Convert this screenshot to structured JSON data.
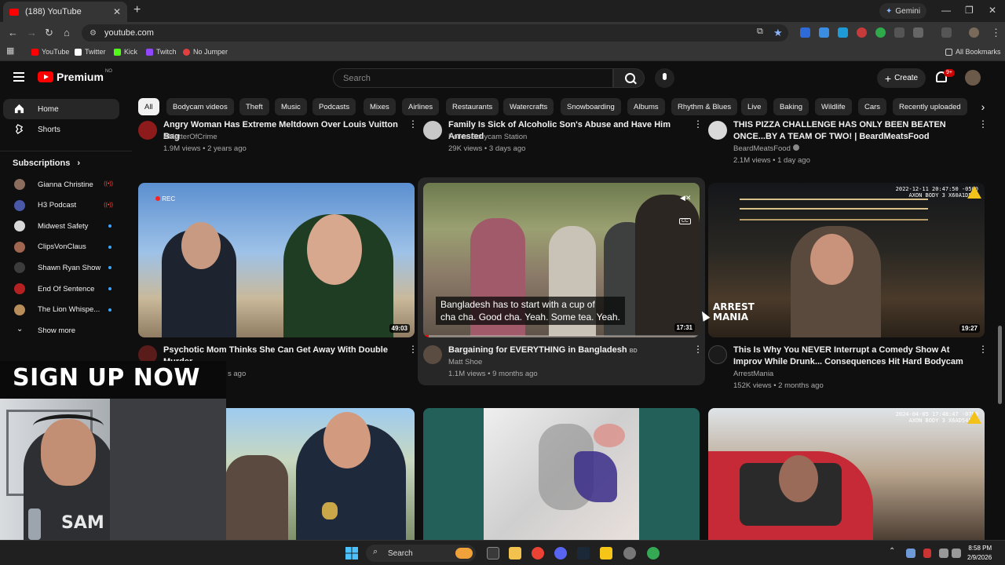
{
  "browser": {
    "tab_title": "(188) YouTube",
    "address": "youtube.com",
    "gemini_label": "Gemini",
    "bookmarks": [
      "YouTube",
      "Twitter",
      "Kick",
      "Twitch",
      "No Jumper"
    ],
    "all_bookmarks": "All Bookmarks"
  },
  "header": {
    "logo": "Premium",
    "logo_sup": "NO",
    "search_placeholder": "Search",
    "create_label": "Create",
    "notif_badge": "9+"
  },
  "sidebar": {
    "nav": [
      {
        "label": "Home",
        "icon": "home-icon"
      },
      {
        "label": "Shorts",
        "icon": "shorts-icon"
      }
    ],
    "subscriptions_title": "Subscriptions",
    "subscriptions": [
      {
        "label": "Gianna Christine",
        "status": "live",
        "color": "#8a6d5c"
      },
      {
        "label": "H3 Podcast",
        "status": "live",
        "color": "#4a58a8"
      },
      {
        "label": "Midwest Safety",
        "status": "dot",
        "color": "#d8d8d8"
      },
      {
        "label": "ClipsVonClaus",
        "status": "dot",
        "color": "#a0664f"
      },
      {
        "label": "Shawn Ryan Show",
        "status": "dot",
        "color": "#3c3c3c"
      },
      {
        "label": "End Of Sentence",
        "status": "dot",
        "color": "#b52020"
      },
      {
        "label": "The Lion Whispe...",
        "status": "dot",
        "color": "#b78d5a"
      }
    ],
    "show_more": "Show more"
  },
  "chips": [
    "All",
    "Bodycam videos",
    "Theft",
    "Music",
    "Podcasts",
    "Mixes",
    "Airlines",
    "Restaurants",
    "Watercrafts",
    "Snowboarding",
    "Albums",
    "Rhythm & Blues",
    "Live",
    "Baking",
    "Wildlife",
    "Cars",
    "Recently uploaded"
  ],
  "videos_top": [
    {
      "title": "Angry Woman  Has Extreme Meltdown Over Louis Vuitton Bag",
      "channel": "AMatterOfCrime",
      "meta": "1.9M views • 2 years ago"
    },
    {
      "title": "Family Is Sick of Alcoholic Son's Abuse and Have Him Arrested",
      "channel": "Police Bodycam Station",
      "meta": "29K views • 3 days ago"
    },
    {
      "title": "THIS PIZZA CHALLENGE HAS ONLY BEEN BEATEN ONCE...BY A TEAM OF TWO! | BeardMeatsFood",
      "channel": "BeardMeatsFood",
      "meta": "2.1M views • 1 day ago"
    }
  ],
  "videos_mid": [
    {
      "title": "Psychotic Mom Thinks She Can Get Away With Double Murder",
      "channel": "",
      "meta": "s ago",
      "duration": "49:03",
      "rec_label": "REC"
    },
    {
      "title": "Bargaining for EVERYTHING in Bangladesh",
      "title_flag": "BD",
      "channel": "Matt Shoe",
      "meta": "1.1M views • 9 months ago",
      "duration": "17:31",
      "caption_line1": "Bangladesh has to start with a cup of",
      "caption_line2": "cha cha. Good cha. Yeah. Some tea. Yeah.",
      "cc": "CC",
      "progress": 0.02
    },
    {
      "title": "This Is Why You NEVER Interrupt a Comedy Show At Improv While Drunk... Consequences Hit Hard Bodycam",
      "channel": "ArrestMania",
      "meta": "152K views • 2 months ago",
      "duration": "19:27",
      "stamp": "2022-12-11 20:47:50 -0500",
      "stamp2": "AXON BODY 3 X60A1D503",
      "logo_line1": "ARREST",
      "logo_line2": "MANIA"
    }
  ],
  "videos_bottom": [
    {
      "stamp": "2024-04-05 17:48:47 -0700",
      "stamp2": "AXON BODY 3 X6AD5456N"
    }
  ],
  "overlay": {
    "sign_up": "SIGN UP NOW",
    "shirt_text": "SAM"
  },
  "taskbar": {
    "search": "Search",
    "time": "8:58 PM",
    "date": "2/9/2026"
  }
}
